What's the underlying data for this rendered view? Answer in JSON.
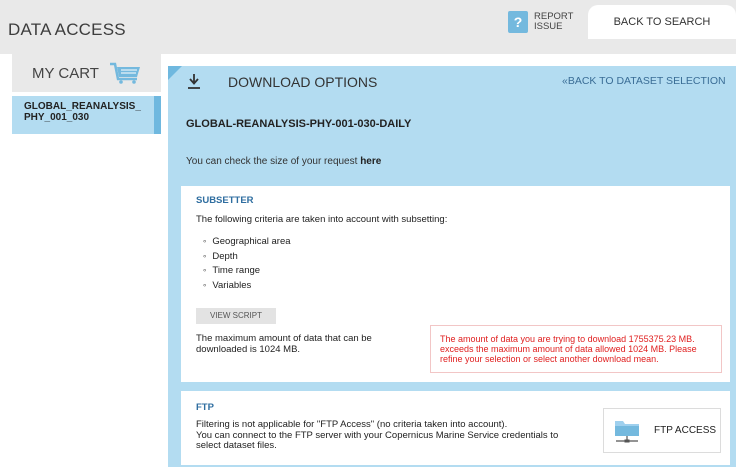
{
  "header": {
    "title": "DATA ACCESS",
    "report_label": "REPORT ISSUE",
    "report_icon": "?",
    "back_to_search": "BACK TO SEARCH"
  },
  "sidebar": {
    "cart_title": "MY CART",
    "item_label": "GLOBAL_REANALYSIS_ PHY_001_030"
  },
  "panel": {
    "title": "DOWNLOAD OPTIONS",
    "back_link": "«BACK TO DATASET SELECTION",
    "dataset_name": "GLOBAL-REANALYSIS-PHY-001-030-DAILY",
    "size_text": "You can check the size of your request ",
    "size_link": "here"
  },
  "subsetter": {
    "title": "SUBSETTER",
    "intro": "The following criteria are taken into account with subsetting:",
    "criteria": [
      "Geographical area",
      "Depth",
      "Time range",
      "Variables"
    ],
    "view_script": "VIEW SCRIPT",
    "max_text": "The maximum amount of data that can be downloaded is 1024 MB.",
    "warning": "The amount of data you are trying to download 1755375.23 MB. exceeds the maximum amount of data allowed 1024 MB. Please refine your selection or select another download mean."
  },
  "ftp": {
    "title": "FTP",
    "line1": "Filtering is not applicable for \"FTP Access\" (no criteria taken into account).",
    "line2": "You can connect to the FTP server with your Copernicus Marine Service credentials to select dataset files.",
    "button_label": "FTP ACCESS"
  },
  "colors": {
    "accent_light": "#b3dcf1",
    "accent": "#6fb8df",
    "link": "#3a6d96",
    "section_title": "#2f6ea0",
    "error": "#e02020"
  }
}
